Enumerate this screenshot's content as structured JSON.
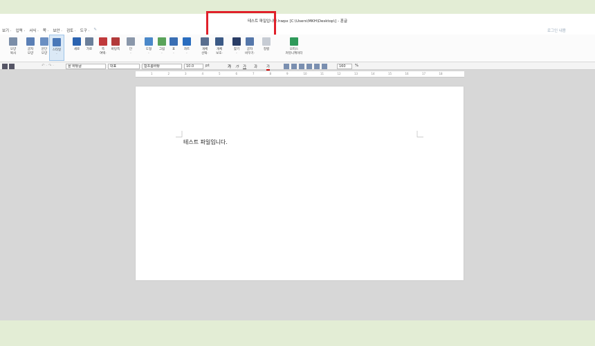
{
  "window": {
    "title": "테스트 파일입니다.hwpx [C:\\Users\\MKH\\Desktop\\] - 훈글"
  },
  "menubar": {
    "items": [
      "보기 ·",
      "입력 ·",
      "서식 ·",
      "쪽 ·",
      "보안 ·",
      "검토 ·",
      "도구 ·",
      "✎"
    ],
    "login": "로그인 내용"
  },
  "ribbon": {
    "buttons": [
      {
        "label": "모양\n복사",
        "icon": "format-painter-icon",
        "color": "#7b8ea8"
      },
      {
        "label": "글자\n모양",
        "icon": "char-shape-icon",
        "color": "#5a7fb5"
      },
      {
        "label": "문단\n모양",
        "icon": "para-shape-icon",
        "color": "#6b8fc2"
      },
      {
        "label": "스타일\n·",
        "icon": "style-icon",
        "color": "#4a78b8"
      },
      {
        "label": "세로",
        "icon": "portrait-icon",
        "color": "#2b63b0"
      },
      {
        "label": "가로",
        "icon": "landscape-icon",
        "color": "#6b7f9a"
      },
      {
        "label": "쪽\n여백·",
        "icon": "margin-icon",
        "color": "#c0393b"
      },
      {
        "label": "바탕쪽",
        "icon": "master-page-icon",
        "color": "#b23a3a"
      },
      {
        "label": "단\n·",
        "icon": "column-icon",
        "color": "#8a97aa"
      },
      {
        "label": "도형\n·",
        "icon": "shape-icon",
        "color": "#4a88c9"
      },
      {
        "label": "그림\n·",
        "icon": "picture-icon",
        "color": "#5aa35a"
      },
      {
        "label": "표\n·",
        "icon": "table-icon",
        "color": "#3a6fb4"
      },
      {
        "label": "차트\n·",
        "icon": "chart-icon",
        "color": "#2a6dbf"
      },
      {
        "label": "개체\n선택·",
        "icon": "select-object-icon",
        "color": "#5a6f8f"
      },
      {
        "label": "개체\n보호·",
        "icon": "protect-object-icon",
        "color": "#3c5a86"
      },
      {
        "label": "찾기\n·",
        "icon": "find-icon",
        "color": "#2a3d66"
      },
      {
        "label": "글자\n바꾸기·",
        "icon": "replace-icon",
        "color": "#5577aa"
      },
      {
        "label": "정렬",
        "icon": "sort-icon",
        "color": "#c7ccd4"
      },
      {
        "label": "오피스\n커뮤니케이터",
        "icon": "office-communicator-icon",
        "color": "#2f9a5a"
      }
    ]
  },
  "formatbar": {
    "style": "꼴 바탕글",
    "lang": "대표",
    "font": "함초롬바탕",
    "size": "10.0",
    "unit": "pt",
    "bold": "가",
    "italic": "가",
    "underline": "가",
    "strike": "과",
    "color": "가",
    "zoom": "160",
    "zoom_unit": "%"
  },
  "ruler": {
    "ticks": [
      "1",
      "2",
      "3",
      "4",
      "5",
      "6",
      "7",
      "8",
      "9",
      "10",
      "11",
      "12",
      "13",
      "14",
      "15",
      "16",
      "17",
      "18"
    ]
  },
  "document": {
    "text": "테스트 파일입니다."
  }
}
